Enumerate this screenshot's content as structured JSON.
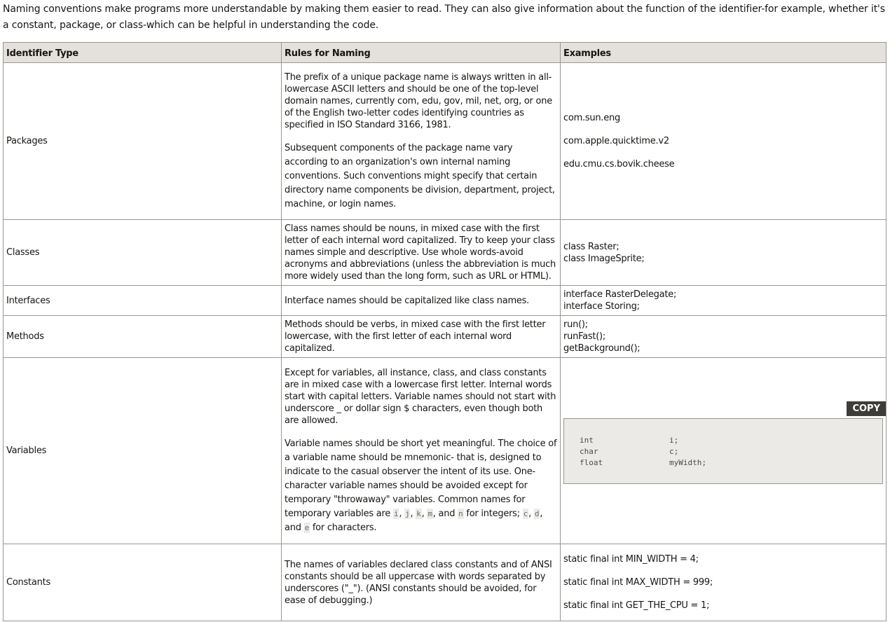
{
  "intro": "Naming conventions make programs more understandable by making them easier to read. They can also give information about the function of the identifier-for example, whether it's a constant, package, or class-which can be helpful in understanding the code.",
  "table": {
    "headers": [
      "Identifier Type",
      "Rules for Naming",
      "Examples"
    ],
    "rows": {
      "packages": {
        "type": "Packages",
        "rules": [
          "The prefix of a unique package name is always written in all-lowercase ASCII letters and should be one of the top-level domain names, currently com, edu, gov, mil, net, org, or one of the English two-letter codes identifying countries as specified in ISO Standard 3166, 1981.",
          "Subsequent components of the package name vary according to an organization's own internal naming conventions. Such conventions might specify that certain directory name components be division, department, project, machine, or login names."
        ],
        "examples": [
          "com.sun.eng",
          "com.apple.quicktime.v2",
          "edu.cmu.cs.bovik.cheese"
        ]
      },
      "classes": {
        "type": "Classes",
        "rules": [
          "Class names should be nouns, in mixed case with the first letter of each internal word capitalized. Try to keep your class names simple and descriptive. Use whole words-avoid acronyms and abbreviations (unless the abbreviation is much more widely used than the long form, such as URL or HTML)."
        ],
        "examples": [
          "class Raster;",
          "class ImageSprite;"
        ]
      },
      "interfaces": {
        "type": "Interfaces",
        "rules": [
          "Interface names should be capitalized like class names."
        ],
        "examples": [
          "interface RasterDelegate;",
          "interface Storing;"
        ]
      },
      "methods": {
        "type": "Methods",
        "rules": [
          "Methods should be verbs, in mixed case with the first letter lowercase, with the first letter of each internal word capitalized."
        ],
        "examples": [
          "run();",
          "runFast();",
          "getBackground();"
        ]
      },
      "variables": {
        "type": "Variables",
        "rules": [
          "Except for variables, all instance, class, and class constants are in mixed case with a lowercase first letter. Internal words start with capital letters. Variable names should not start with underscore _ or dollar sign $ characters, even though both are allowed.",
          "Variable names should be short yet meaningful. The choice of a variable name should be mnemonic- that is, designed to indicate to the casual observer the intent of its use. One-character variable names should be avoided except for temporary \"throwaway\" variables. Common names for temporary variables are"
        ],
        "inline_codes": [
          "i",
          "j",
          "k",
          "m",
          "n",
          "c",
          "d",
          "e"
        ],
        "inline_text": {
          "sep": ", ",
          "and": ", and ",
          "for_integers": " for integers; ",
          "for_characters": "for characters."
        },
        "copy_label": "COPY",
        "code": [
          {
            "type": "int",
            "name": "i;"
          },
          {
            "type": "char",
            "name": "c;"
          },
          {
            "type": "float",
            "name": "myWidth;"
          }
        ]
      },
      "constants": {
        "type": "Constants",
        "rules": [
          "The names of variables declared class constants and of ANSI constants should be all uppercase with words separated by underscores (\"_\"). (ANSI constants should be avoided, for ease of debugging.)"
        ],
        "examples": [
          "static final int MIN_WIDTH = 4;",
          "static final int MAX_WIDTH = 999;",
          "static final int GET_THE_CPU = 1;"
        ]
      }
    }
  }
}
